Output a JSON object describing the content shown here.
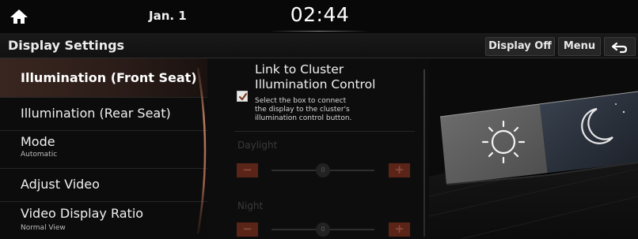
{
  "status_bar": {
    "date": "Jan. 1",
    "time": "02:44"
  },
  "header": {
    "title": "Display Settings",
    "display_off_label": "Display Off",
    "menu_label": "Menu"
  },
  "menu": {
    "items": [
      {
        "label": "Illumination (Front Seat)",
        "selected": true
      },
      {
        "label": "Illumination (Rear Seat)"
      },
      {
        "label": "Mode",
        "sublabel": "Automatic"
      },
      {
        "label": "Adjust Video"
      },
      {
        "label": "Video Display Ratio",
        "sublabel": "Normal View"
      }
    ]
  },
  "panel": {
    "link_title_line1": "Link to Cluster",
    "link_title_line2": "Illumination Control",
    "link_checked": true,
    "description_lines": [
      "Select the box to connect",
      "the display to the cluster's",
      "illumination control button."
    ],
    "daylight": {
      "label": "Daylight",
      "value": "0",
      "minus": "−",
      "plus": "+"
    },
    "night": {
      "label": "Night",
      "value": "0",
      "minus": "−",
      "plus": "+"
    }
  },
  "icons": {
    "home": "home-icon",
    "back": "back-arrow-icon",
    "check": "checkmark-icon",
    "sun": "sun-icon",
    "moon": "moon-icon"
  },
  "colors": {
    "accent": "#5a2418",
    "selected_item": "#3a2620",
    "background": "#0b0b0b"
  }
}
